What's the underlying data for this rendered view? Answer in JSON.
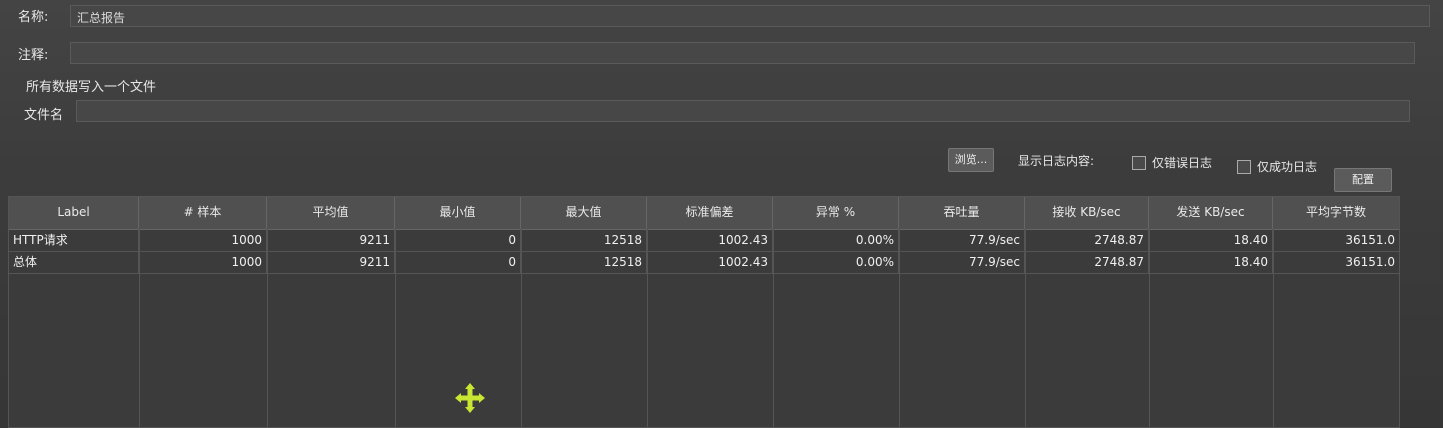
{
  "form": {
    "name_label": "名称:",
    "name_value": "汇总报告",
    "comment_label": "注释:",
    "comment_value": "",
    "write_all_label": "所有数据写入一个文件",
    "filename_label": "文件名",
    "filename_value": "",
    "browse_button": "浏览...",
    "show_log_label": "显示日志内容:",
    "errors_only_label": "仅错误日志",
    "success_only_label": "仅成功日志",
    "configure_button": "配置"
  },
  "table": {
    "columns": [
      "Label",
      "# 样本",
      "平均值",
      "最小值",
      "最大值",
      "标准偏差",
      "异常 %",
      "吞吐量",
      "接收 KB/sec",
      "发送 KB/sec",
      "平均字节数"
    ],
    "rows": [
      [
        "HTTP请求",
        "1000",
        "9211",
        "0",
        "12518",
        "1002.43",
        "0.00%",
        "77.9/sec",
        "2748.87",
        "18.40",
        "36151.0"
      ],
      [
        "总体",
        "1000",
        "9211",
        "0",
        "12518",
        "1002.43",
        "0.00%",
        "77.9/sec",
        "2748.87",
        "18.40",
        "36151.0"
      ]
    ]
  },
  "icons": {
    "cursor": "move-cursor-icon",
    "cursor_color": "#c8e632"
  }
}
